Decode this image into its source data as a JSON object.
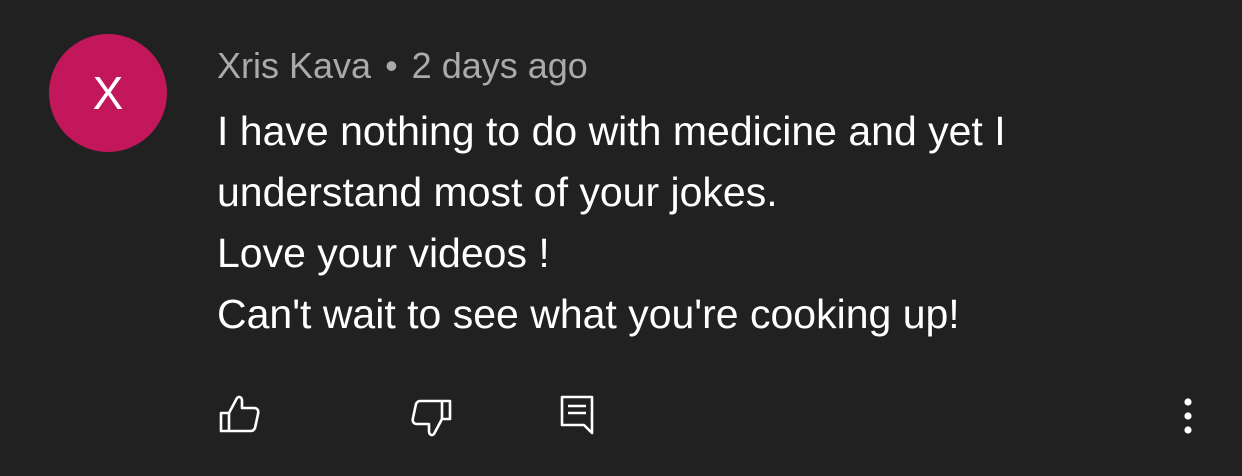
{
  "comment": {
    "avatar_letter": "X",
    "author": "Xris Kava",
    "separator": "•",
    "timestamp": "2 days ago",
    "body_lines": [
      "I have nothing to do with medicine and yet I",
      "understand most of your jokes.",
      "Love your videos !",
      "Can't wait to see what you're cooking up!"
    ]
  },
  "actions": {
    "like_icon": "thumbs-up-icon",
    "dislike_icon": "thumbs-down-icon",
    "reply_icon": "comment-reply-icon",
    "more_icon": "more-vertical-icon"
  },
  "colors": {
    "background": "#212121",
    "avatar": "#c2185b",
    "meta_text": "#aaaaaa",
    "body_text": "#ffffff",
    "icon": "#ffffff"
  }
}
